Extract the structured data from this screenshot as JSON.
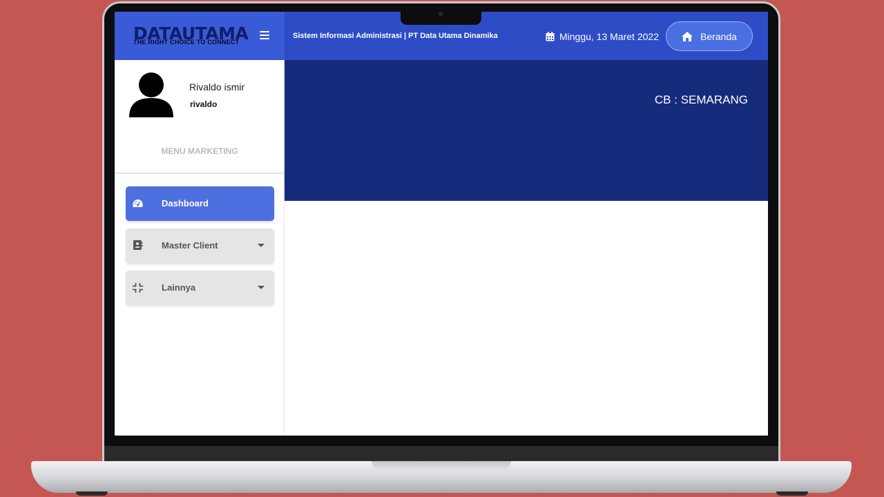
{
  "header": {
    "logo_main": "DATAUTAMA",
    "logo_tagline": "THE RIGHT CHOICE TO CONNECT",
    "app_title": "Sistem Informasi Administrasi | PT Data Utama Dinamika",
    "date": "Minggu, 13 Maret 2022",
    "home_button_label": "Beranda",
    "menu_icon": "hamburger-icon",
    "calendar_icon": "calendar-icon",
    "home_icon": "home-icon"
  },
  "user": {
    "name": "Rivaldo ismir",
    "username": "rivaldo",
    "avatar_icon": "user-avatar-icon"
  },
  "sidebar": {
    "heading": "MENU MARKETING",
    "items": [
      {
        "label": "Dashboard",
        "icon": "dashboard-gauge-icon",
        "active": true
      },
      {
        "label": "Master Client",
        "icon": "address-book-icon",
        "has_dropdown": true
      },
      {
        "label": "Lainnya",
        "icon": "compress-icon",
        "has_dropdown": true
      }
    ]
  },
  "main": {
    "branch": "CB : SEMARANG"
  },
  "colors": {
    "page_background": "#c45752",
    "header_left": "#3a5bd7",
    "header_right": "#2e4cc6",
    "hero": "#162b7c",
    "active_nav": "#4e6fe0"
  }
}
